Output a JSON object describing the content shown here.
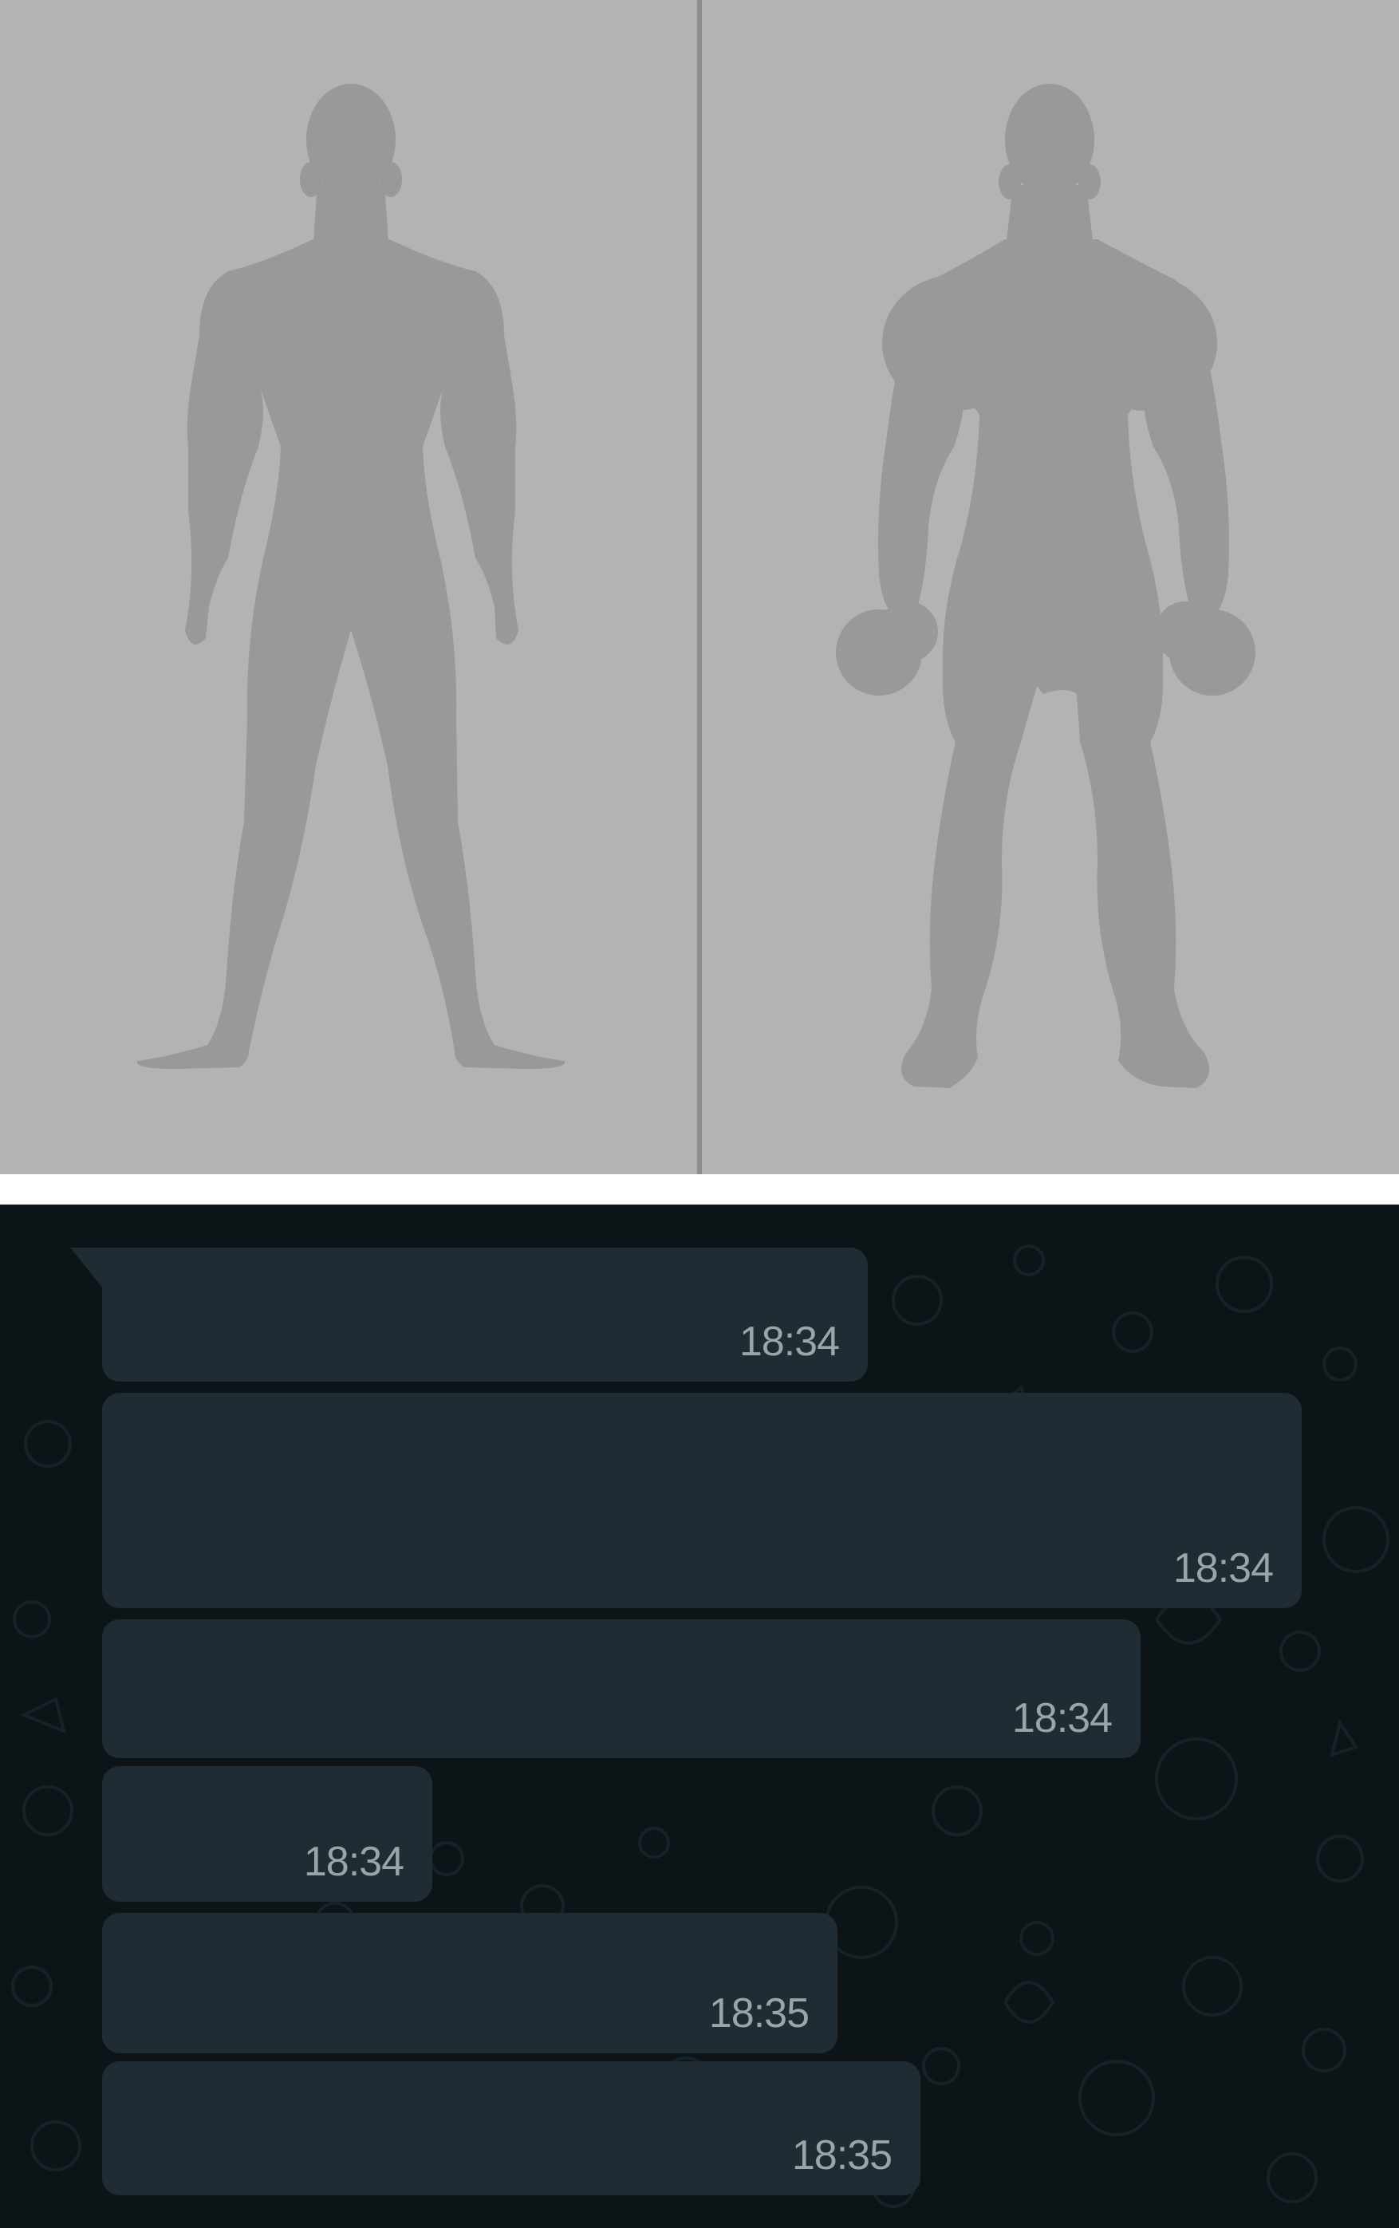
{
  "comparison": {
    "left_figure_icon": "slim-body-icon",
    "right_figure_icon": "muscular-body-with-dumbbells-icon",
    "colors": {
      "background": "#b3b3b3",
      "silhouette": "#999999",
      "divider": "#8e8e8e"
    }
  },
  "chat": {
    "colors": {
      "background": "#0c1418",
      "bubble": "#202c33",
      "timestamp": "#9aa4aa"
    },
    "messages": [
      {
        "time": "18:34"
      },
      {
        "time": "18:34"
      },
      {
        "time": "18:34"
      },
      {
        "time": "18:34"
      },
      {
        "time": "18:35"
      },
      {
        "time": "18:35"
      }
    ]
  }
}
